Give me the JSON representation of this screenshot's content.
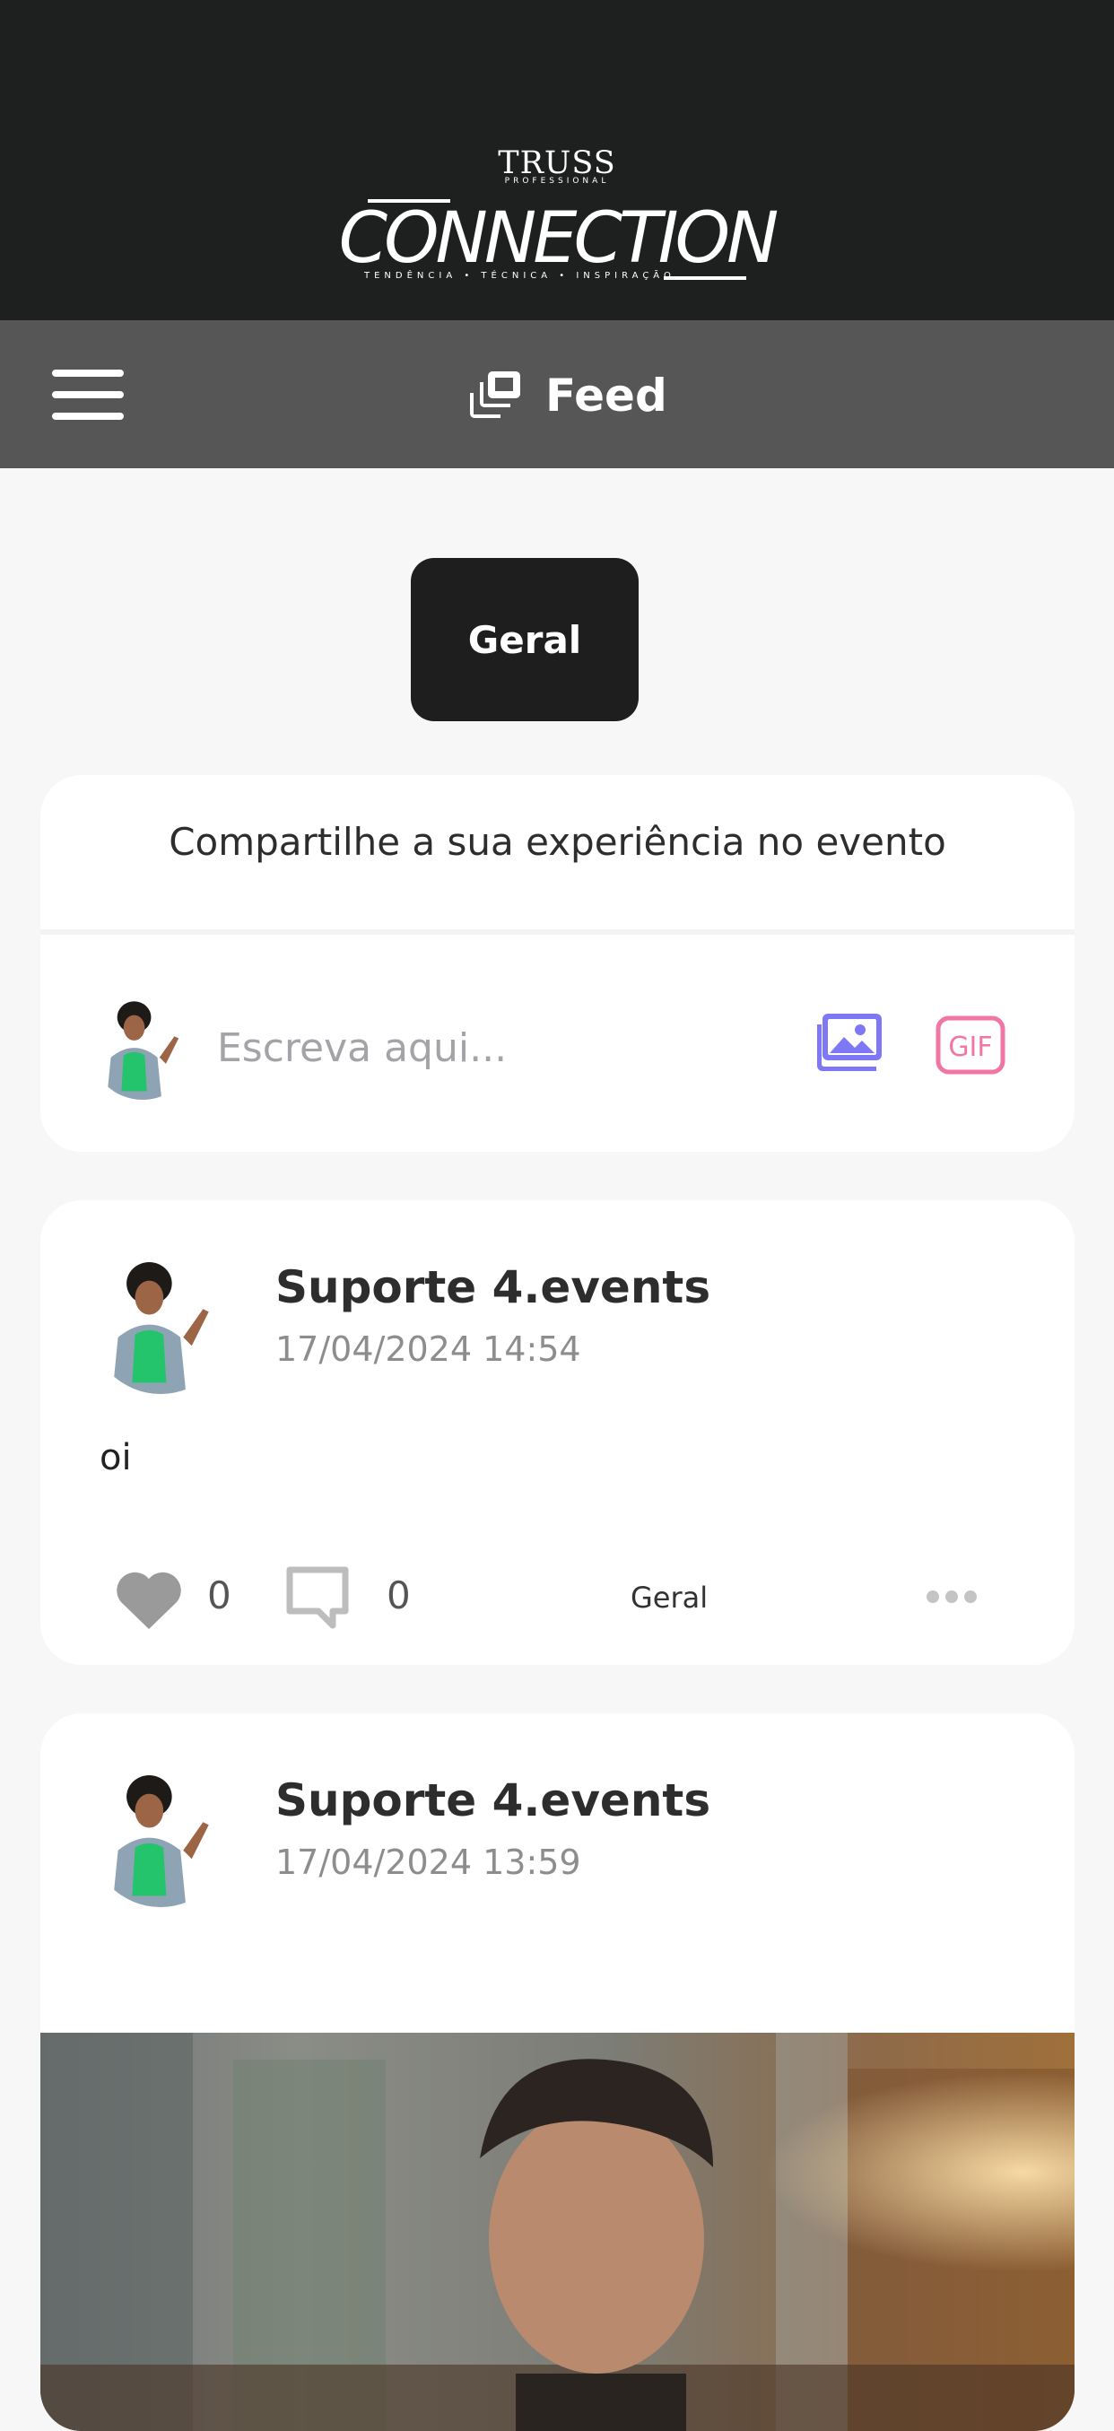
{
  "header": {
    "logo": {
      "brand": "TRUSS",
      "sub": "PROFESSIONAL",
      "title": "CONNECTION",
      "tagline": "TENDÊNCIA • TÉCNICA • INSPIRAÇÃO"
    }
  },
  "navbar": {
    "menu_icon": "hamburger-menu-icon",
    "title_icon": "stacked-cards-icon",
    "title": "Feed"
  },
  "filter": {
    "active_tab": "Geral"
  },
  "compose": {
    "title": "Compartilhe a sua experiência no evento",
    "placeholder": "Escreva aqui...",
    "image_icon": "image-gallery-icon",
    "gif_icon": "gif-icon",
    "image_icon_color": "#7f78f6",
    "gif_icon_color": "#f276a4"
  },
  "posts": [
    {
      "author": "Suporte 4.events",
      "date": "17/04/2024 14:54",
      "text": "oi",
      "likes": "0",
      "comments": "0",
      "category": "Geral"
    },
    {
      "author": "Suporte 4.events",
      "date": "17/04/2024 13:59"
    }
  ]
}
